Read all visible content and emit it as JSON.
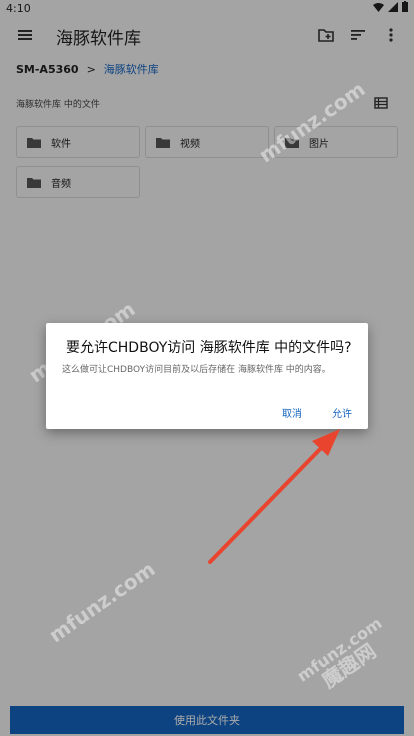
{
  "status": {
    "time": "4:10"
  },
  "appbar": {
    "title": "海豚软件库"
  },
  "breadcrumb": {
    "root": "SM-A5360",
    "separator": ">",
    "current": "海豚软件库"
  },
  "section_label": "海豚软件库 中的文件",
  "folders": [
    {
      "name": "软件"
    },
    {
      "name": "视频"
    },
    {
      "name": "图片"
    },
    {
      "name": "音频"
    }
  ],
  "dialog": {
    "title": "要允许CHDBOY访问 海豚软件库 中的文件吗?",
    "message": "这么做可让CHDBOY访问目前及以后存储在 海豚软件库 中的内容。",
    "cancel": "取消",
    "allow": "允许"
  },
  "bottom_button": "使用此文件夹",
  "watermarks": [
    "mfunz.com",
    "mfunz.com",
    "mfunz.com",
    "魔趣网",
    "mfunz.com"
  ],
  "colors": {
    "accent": "#1565c0",
    "arrow": "#e8442e"
  }
}
